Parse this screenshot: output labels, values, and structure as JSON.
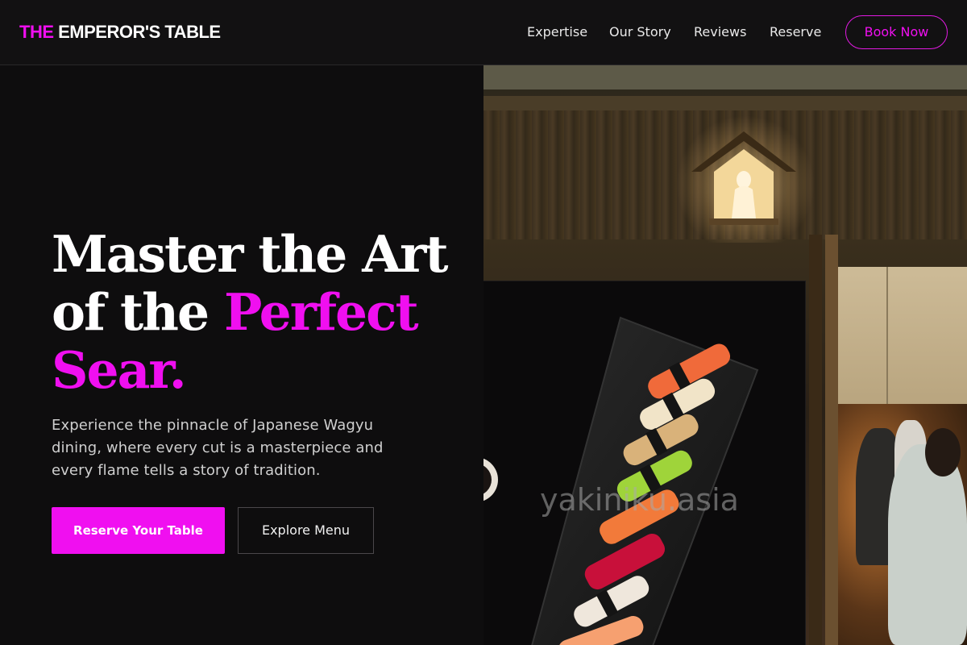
{
  "header": {
    "logo_accent": "THE",
    "logo_rest": "EMPEROR'S TABLE",
    "nav": [
      "Expertise",
      "Our Story",
      "Reviews",
      "Reserve"
    ],
    "cta": "Book Now"
  },
  "hero": {
    "title_line1": "Master the Art",
    "title_line2_plain": "of the",
    "title_line2_accent": "Perfect",
    "title_line3_accent": "Sear.",
    "subtitle": "Experience the pinnacle of Japanese Wagyu dining, where every cut is a masterpiece and every flame tells a story of tradition.",
    "primary_button": "Reserve Your Table",
    "secondary_button": "Explore Menu"
  },
  "imagery": {
    "watermark": "yakiniku.asia"
  },
  "colors": {
    "accent": "#f00ff0",
    "background": "#0e0d0e",
    "header_bg": "#121112"
  }
}
